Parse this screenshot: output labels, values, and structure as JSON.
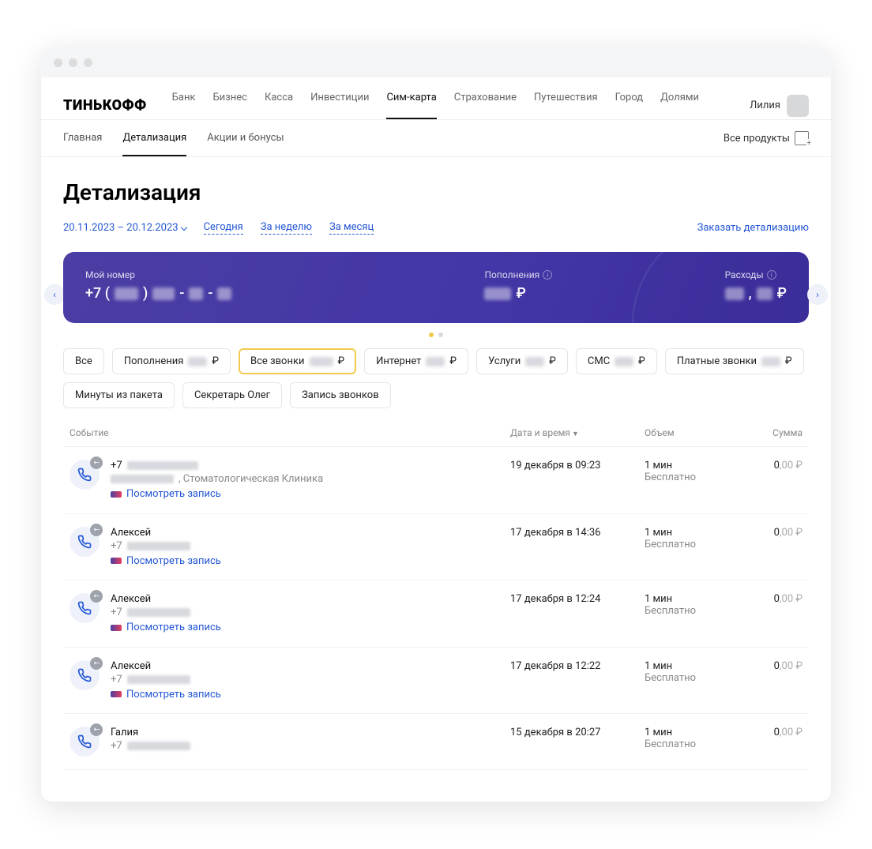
{
  "header": {
    "logo": "ТИНЬКОФФ",
    "nav": [
      "Банк",
      "Бизнес",
      "Касса",
      "Инвестиции",
      "Сим-карта",
      "Страхование",
      "Путешествия",
      "Город",
      "Долями"
    ],
    "nav_active_index": 4,
    "user_name": "Лилия"
  },
  "subnav": {
    "items": [
      "Главная",
      "Детализация",
      "Акции и бонусы"
    ],
    "active_index": 1,
    "all_products": "Все продукты"
  },
  "page": {
    "title": "Детализация",
    "date_range": "20.11.2023 – 20.12.2023",
    "quick_links": [
      "Сегодня",
      "За неделю",
      "За месяц"
    ],
    "order_link": "Заказать детализацию"
  },
  "hero": {
    "my_number_label": "Мой номер",
    "my_number_prefix": "+7 (",
    "my_number_mid": ") ",
    "topups_label": "Пополнения",
    "expenses_label": "Расходы",
    "currency": "₽"
  },
  "chips": [
    {
      "label": "Все",
      "suffix": "",
      "active": false
    },
    {
      "label": "Пополнения",
      "suffix": "₽",
      "active": false,
      "blurred": true
    },
    {
      "label": "Все звонки",
      "suffix": "₽",
      "active": true,
      "blurred": true
    },
    {
      "label": "Интернет",
      "suffix": "₽",
      "active": false,
      "blurred": true
    },
    {
      "label": "Услуги",
      "suffix": "₽",
      "active": false,
      "blurred": true
    },
    {
      "label": "СМС",
      "suffix": "₽",
      "active": false,
      "blurred": true
    },
    {
      "label": "Платные звонки",
      "suffix": "₽",
      "active": false,
      "blurred": true
    },
    {
      "label": "Минуты из пакета",
      "suffix": "",
      "active": false
    },
    {
      "label": "Секретарь Олег",
      "suffix": "",
      "active": false
    },
    {
      "label": "Запись звонков",
      "suffix": "",
      "active": false
    }
  ],
  "table": {
    "cols": {
      "event": "Событие",
      "date": "Дата и время",
      "volume": "Объем",
      "sum": "Сумма"
    },
    "view_record": "Посмотреть запись",
    "free_label": "Бесплатно",
    "rows": [
      {
        "title": "+7",
        "title_blurred": true,
        "sub_extra": ", Стоматологическая Клиника",
        "date": "19 декабря в 09:23",
        "volume": "1 мин",
        "sum_int": "0",
        "sum_dec": ",00 ₽",
        "has_record": true,
        "has_sub_number": true
      },
      {
        "title": "Алексей",
        "sub_prefix": "+7",
        "date": "17 декабря в 14:36",
        "volume": "1 мин",
        "sum_int": "0",
        "sum_dec": ",00 ₽",
        "has_record": true,
        "has_sub_number": true
      },
      {
        "title": "Алексей",
        "sub_prefix": "+7",
        "date": "17 декабря в 12:24",
        "volume": "1 мин",
        "sum_int": "0",
        "sum_dec": ",00 ₽",
        "has_record": true,
        "has_sub_number": true
      },
      {
        "title": "Алексей",
        "sub_prefix": "+7",
        "date": "17 декабря в 12:22",
        "volume": "1 мин",
        "sum_int": "0",
        "sum_dec": ",00 ₽",
        "has_record": true,
        "has_sub_number": true
      },
      {
        "title": "Галия",
        "sub_prefix": "+7",
        "date": "15 декабря в 20:27",
        "volume": "1 мин",
        "sum_int": "0",
        "sum_dec": ",00 ₽",
        "has_record": false,
        "has_sub_number": true
      }
    ]
  }
}
